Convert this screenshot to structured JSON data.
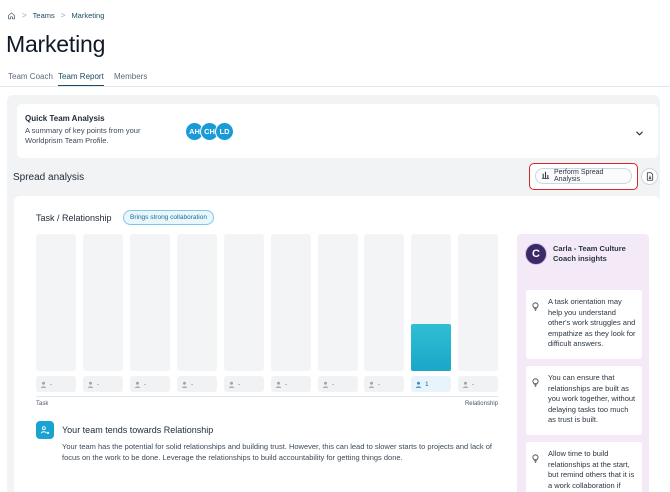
{
  "breadcrumb": {
    "home_icon": "home-icon",
    "items": [
      "Teams",
      "Marketing"
    ],
    "separator": ">"
  },
  "page": {
    "title": "Marketing"
  },
  "tabs": [
    {
      "label": "Team Coach",
      "active": false
    },
    {
      "label": "Team Report",
      "active": true
    },
    {
      "label": "Members",
      "active": false
    }
  ],
  "quick_analysis": {
    "title": "Quick Team Analysis",
    "description": "A summary of key points from your Worldprism Team Profile.",
    "avatars": [
      "AH",
      "CH",
      "LD"
    ],
    "avatar_color": "#1a9bd7"
  },
  "spread": {
    "title": "Spread analysis",
    "perform_label": "Perform Spread Analysis",
    "highlight_color": "#d7262c"
  },
  "task_relationship": {
    "title": "Task / Relationship",
    "badge": "Brings strong collaboration",
    "axis_left": "Task",
    "axis_right": "Relationship",
    "columns": [
      {
        "count": "-",
        "level": 0
      },
      {
        "count": "-",
        "level": 0
      },
      {
        "count": "-",
        "level": 0
      },
      {
        "count": "-",
        "level": 0
      },
      {
        "count": "-",
        "level": 0
      },
      {
        "count": "-",
        "level": 0
      },
      {
        "count": "-",
        "level": 0
      },
      {
        "count": "-",
        "level": 0
      },
      {
        "count": "1",
        "level": 0.34
      },
      {
        "count": "-",
        "level": 0
      }
    ]
  },
  "insight": {
    "title": "Your team tends towards Relationship",
    "body": "Your team has the potential for solid relationships and building trust. However, this can lead to slower starts to projects and lack of focus on the work to be done. Leverage the relationships to build accountability for getting things done."
  },
  "coach": {
    "avatar_letter": "C",
    "name": "Carla - Team Culture Coach insights",
    "tips": [
      "A task orientation may help you understand other's work struggles and empathize as they look for difficult answers.",
      "You can ensure that relationships are built as you work together, without delaying tasks too much as trust is built.",
      "Allow time to build relationships at the start, but remind others that it is a work collaboration if"
    ]
  }
}
